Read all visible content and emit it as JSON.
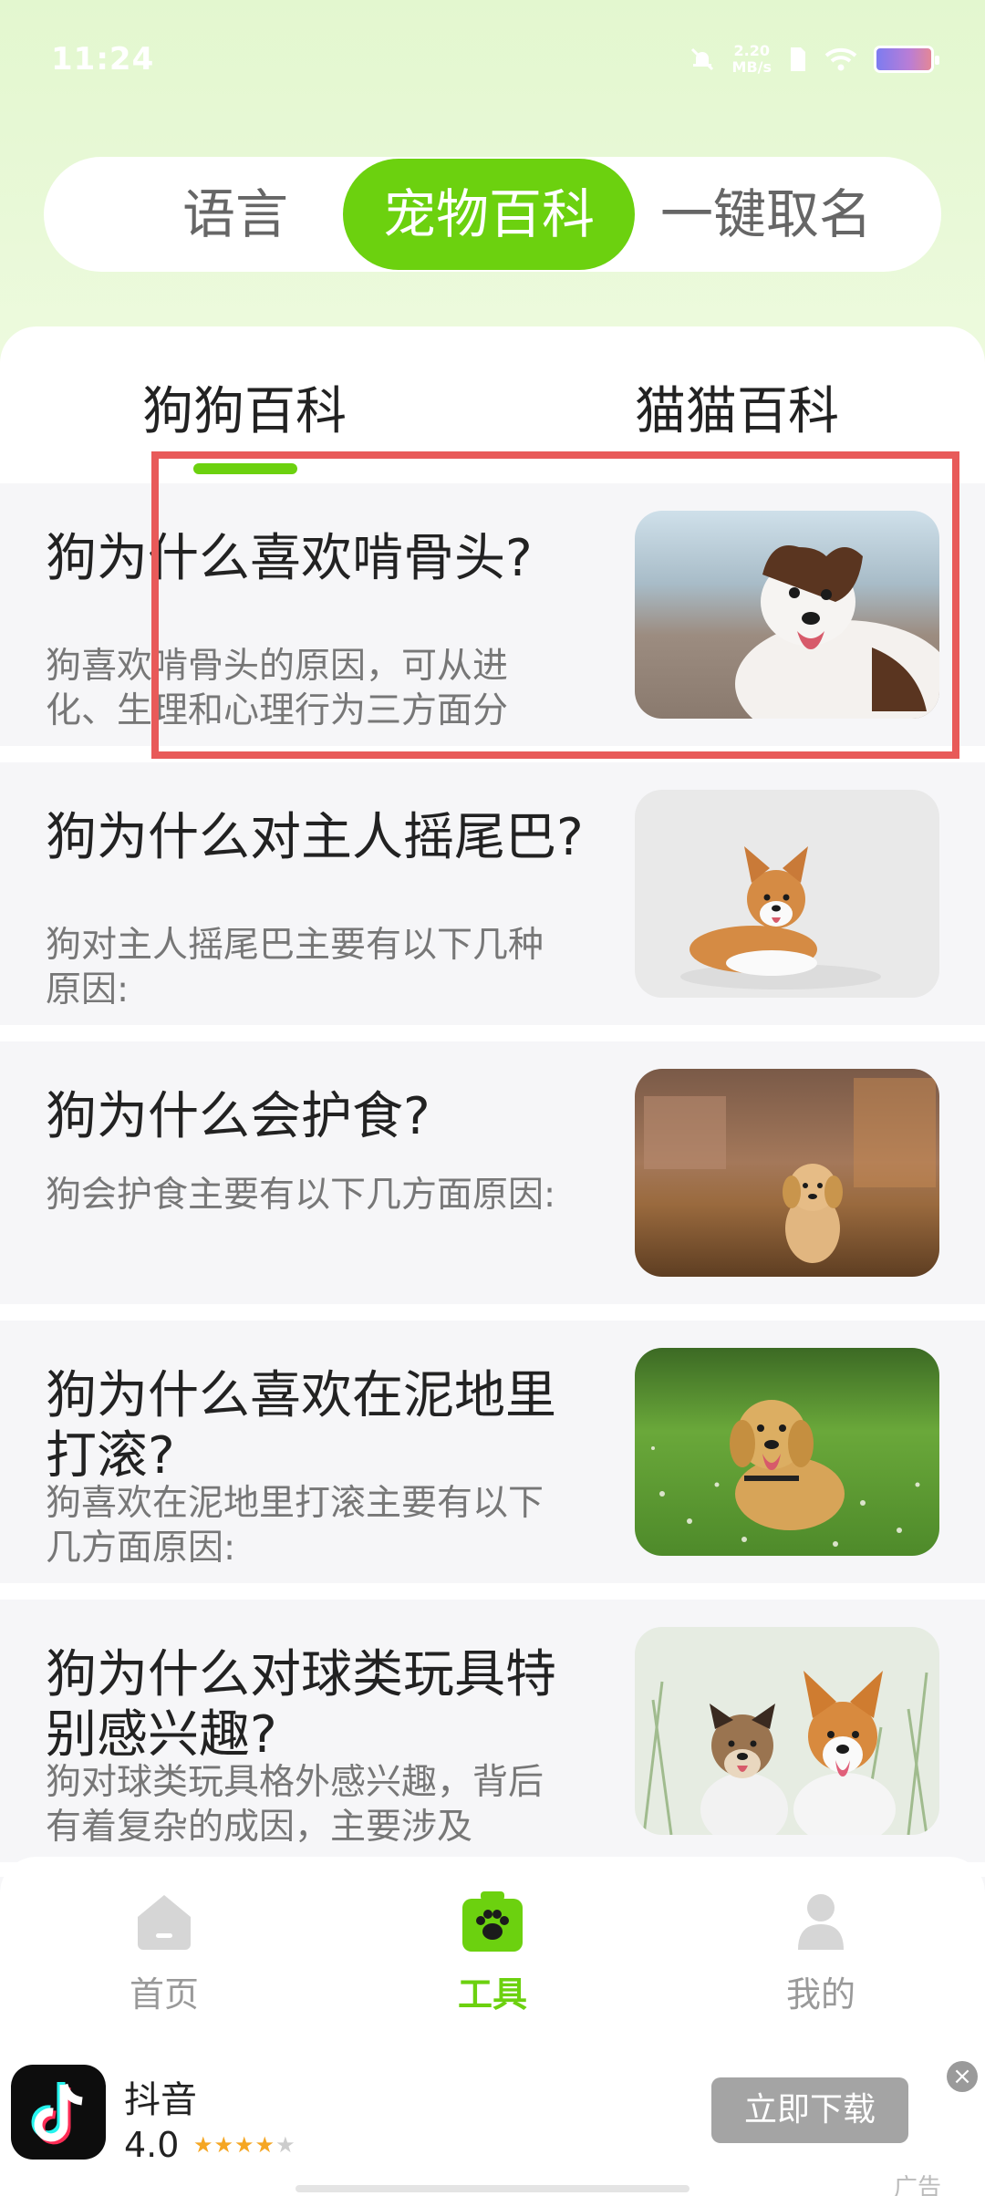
{
  "status_bar": {
    "time": "11:24",
    "net_speed": "2.20",
    "net_unit": "MB/s"
  },
  "segment": {
    "tabs": [
      {
        "label": "语言"
      },
      {
        "label": "宠物百科"
      },
      {
        "label": "一键取名"
      }
    ],
    "active_index": 1
  },
  "sub_tabs": [
    {
      "label": "狗狗百科"
    },
    {
      "label": "猫猫百科"
    }
  ],
  "articles": [
    {
      "title": "狗为什么喜欢啃骨头?",
      "desc": "狗喜欢啃骨头的原因，可从进化、生理和心理行为三方面分",
      "image": "dog-border-collie-beach"
    },
    {
      "title": "狗为什么对主人摇尾巴?",
      "desc": "狗对主人摇尾巴主要有以下几种原因:",
      "image": "dog-corgi-white-bg"
    },
    {
      "title": "狗为什么会护食?",
      "desc": "狗会护食主要有以下几方面原因:",
      "image": "dog-golden-puppy-field"
    },
    {
      "title": "狗为什么喜欢在泥地里打滚?",
      "desc": "狗喜欢在泥地里打滚主要有以下几方面原因:",
      "image": "dog-golden-retriever-grass"
    },
    {
      "title": "狗为什么对球类玩具特别感兴趣?",
      "desc": "狗对球类玩具格外感兴趣，背后有着复杂的成因，主要涉及",
      "image": "dogs-terrier-corgi"
    }
  ],
  "bottom_nav": [
    {
      "label": "首页",
      "icon": "home-icon"
    },
    {
      "label": "工具",
      "icon": "paw-toolbox-icon"
    },
    {
      "label": "我的",
      "icon": "person-icon"
    }
  ],
  "bottom_nav_active": 1,
  "ad": {
    "app_name": "抖音",
    "rating": "4.0",
    "stars": "★★★★",
    "stars_dim": "★",
    "button": "立即下载",
    "close": "×",
    "tag": "广告"
  },
  "colors": {
    "accent": "#6cd10f",
    "highlight": "#e85a59",
    "top_bg": "#e3f7cf"
  }
}
